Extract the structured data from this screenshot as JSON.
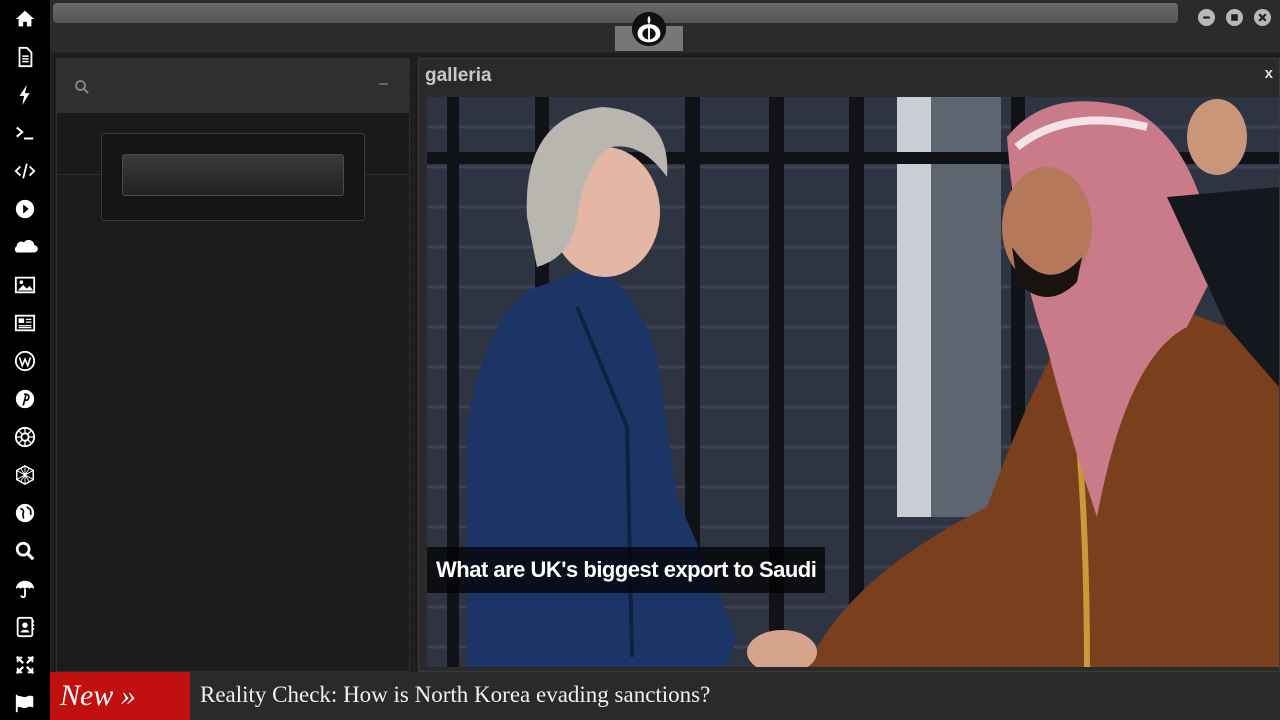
{
  "sidebar": {
    "icons": [
      {
        "name": "home-icon"
      },
      {
        "name": "document-icon"
      },
      {
        "name": "lightning-icon"
      },
      {
        "name": "terminal-icon"
      },
      {
        "name": "code-icon"
      },
      {
        "name": "play-icon"
      },
      {
        "name": "cloud-icon"
      },
      {
        "name": "image-icon"
      },
      {
        "name": "newspaper-icon"
      },
      {
        "name": "wordpress-icon"
      },
      {
        "name": "pinterest-icon"
      },
      {
        "name": "empire-icon"
      },
      {
        "name": "network-sphere-icon"
      },
      {
        "name": "globe-icon"
      },
      {
        "name": "search-icon"
      },
      {
        "name": "umbrella-icon"
      },
      {
        "name": "contacts-icon"
      },
      {
        "name": "fullscreen-icon"
      },
      {
        "name": "flag-icon"
      }
    ]
  },
  "search": {
    "placeholder": "",
    "minimize_label": "–"
  },
  "gallery": {
    "title": "galleria",
    "close_label": "x",
    "caption": "What are UK's biggest export to Saudi"
  },
  "ticker": {
    "badge": "New »",
    "headline": "Reality Check: How is North Korea evading sanctions?"
  },
  "colors": {
    "ticker_badge": "#c01010",
    "rail": "#000000",
    "panel": "#2f2f2f"
  }
}
